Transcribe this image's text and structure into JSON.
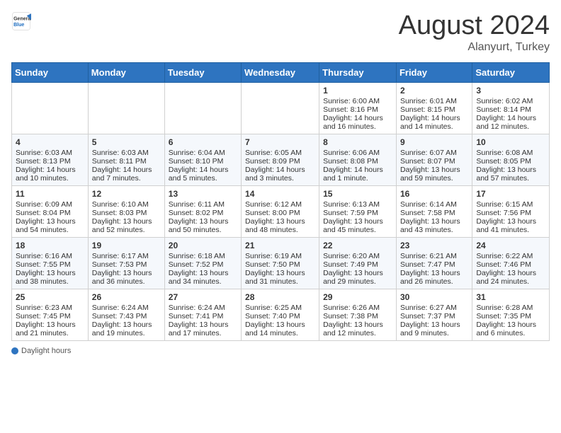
{
  "header": {
    "logo_general": "General",
    "logo_blue": "Blue",
    "title": "August 2024",
    "location": "Alanyurt, Turkey"
  },
  "days_of_week": [
    "Sunday",
    "Monday",
    "Tuesday",
    "Wednesday",
    "Thursday",
    "Friday",
    "Saturday"
  ],
  "weeks": [
    [
      {
        "day": "",
        "sunrise": "",
        "sunset": "",
        "daylight": ""
      },
      {
        "day": "",
        "sunrise": "",
        "sunset": "",
        "daylight": ""
      },
      {
        "day": "",
        "sunrise": "",
        "sunset": "",
        "daylight": ""
      },
      {
        "day": "",
        "sunrise": "",
        "sunset": "",
        "daylight": ""
      },
      {
        "day": "1",
        "sunrise": "Sunrise: 6:00 AM",
        "sunset": "Sunset: 8:16 PM",
        "daylight": "Daylight: 14 hours and 16 minutes."
      },
      {
        "day": "2",
        "sunrise": "Sunrise: 6:01 AM",
        "sunset": "Sunset: 8:15 PM",
        "daylight": "Daylight: 14 hours and 14 minutes."
      },
      {
        "day": "3",
        "sunrise": "Sunrise: 6:02 AM",
        "sunset": "Sunset: 8:14 PM",
        "daylight": "Daylight: 14 hours and 12 minutes."
      }
    ],
    [
      {
        "day": "4",
        "sunrise": "Sunrise: 6:03 AM",
        "sunset": "Sunset: 8:13 PM",
        "daylight": "Daylight: 14 hours and 10 minutes."
      },
      {
        "day": "5",
        "sunrise": "Sunrise: 6:03 AM",
        "sunset": "Sunset: 8:11 PM",
        "daylight": "Daylight: 14 hours and 7 minutes."
      },
      {
        "day": "6",
        "sunrise": "Sunrise: 6:04 AM",
        "sunset": "Sunset: 8:10 PM",
        "daylight": "Daylight: 14 hours and 5 minutes."
      },
      {
        "day": "7",
        "sunrise": "Sunrise: 6:05 AM",
        "sunset": "Sunset: 8:09 PM",
        "daylight": "Daylight: 14 hours and 3 minutes."
      },
      {
        "day": "8",
        "sunrise": "Sunrise: 6:06 AM",
        "sunset": "Sunset: 8:08 PM",
        "daylight": "Daylight: 14 hours and 1 minute."
      },
      {
        "day": "9",
        "sunrise": "Sunrise: 6:07 AM",
        "sunset": "Sunset: 8:07 PM",
        "daylight": "Daylight: 13 hours and 59 minutes."
      },
      {
        "day": "10",
        "sunrise": "Sunrise: 6:08 AM",
        "sunset": "Sunset: 8:05 PM",
        "daylight": "Daylight: 13 hours and 57 minutes."
      }
    ],
    [
      {
        "day": "11",
        "sunrise": "Sunrise: 6:09 AM",
        "sunset": "Sunset: 8:04 PM",
        "daylight": "Daylight: 13 hours and 54 minutes."
      },
      {
        "day": "12",
        "sunrise": "Sunrise: 6:10 AM",
        "sunset": "Sunset: 8:03 PM",
        "daylight": "Daylight: 13 hours and 52 minutes."
      },
      {
        "day": "13",
        "sunrise": "Sunrise: 6:11 AM",
        "sunset": "Sunset: 8:02 PM",
        "daylight": "Daylight: 13 hours and 50 minutes."
      },
      {
        "day": "14",
        "sunrise": "Sunrise: 6:12 AM",
        "sunset": "Sunset: 8:00 PM",
        "daylight": "Daylight: 13 hours and 48 minutes."
      },
      {
        "day": "15",
        "sunrise": "Sunrise: 6:13 AM",
        "sunset": "Sunset: 7:59 PM",
        "daylight": "Daylight: 13 hours and 45 minutes."
      },
      {
        "day": "16",
        "sunrise": "Sunrise: 6:14 AM",
        "sunset": "Sunset: 7:58 PM",
        "daylight": "Daylight: 13 hours and 43 minutes."
      },
      {
        "day": "17",
        "sunrise": "Sunrise: 6:15 AM",
        "sunset": "Sunset: 7:56 PM",
        "daylight": "Daylight: 13 hours and 41 minutes."
      }
    ],
    [
      {
        "day": "18",
        "sunrise": "Sunrise: 6:16 AM",
        "sunset": "Sunset: 7:55 PM",
        "daylight": "Daylight: 13 hours and 38 minutes."
      },
      {
        "day": "19",
        "sunrise": "Sunrise: 6:17 AM",
        "sunset": "Sunset: 7:53 PM",
        "daylight": "Daylight: 13 hours and 36 minutes."
      },
      {
        "day": "20",
        "sunrise": "Sunrise: 6:18 AM",
        "sunset": "Sunset: 7:52 PM",
        "daylight": "Daylight: 13 hours and 34 minutes."
      },
      {
        "day": "21",
        "sunrise": "Sunrise: 6:19 AM",
        "sunset": "Sunset: 7:50 PM",
        "daylight": "Daylight: 13 hours and 31 minutes."
      },
      {
        "day": "22",
        "sunrise": "Sunrise: 6:20 AM",
        "sunset": "Sunset: 7:49 PM",
        "daylight": "Daylight: 13 hours and 29 minutes."
      },
      {
        "day": "23",
        "sunrise": "Sunrise: 6:21 AM",
        "sunset": "Sunset: 7:47 PM",
        "daylight": "Daylight: 13 hours and 26 minutes."
      },
      {
        "day": "24",
        "sunrise": "Sunrise: 6:22 AM",
        "sunset": "Sunset: 7:46 PM",
        "daylight": "Daylight: 13 hours and 24 minutes."
      }
    ],
    [
      {
        "day": "25",
        "sunrise": "Sunrise: 6:23 AM",
        "sunset": "Sunset: 7:45 PM",
        "daylight": "Daylight: 13 hours and 21 minutes."
      },
      {
        "day": "26",
        "sunrise": "Sunrise: 6:24 AM",
        "sunset": "Sunset: 7:43 PM",
        "daylight": "Daylight: 13 hours and 19 minutes."
      },
      {
        "day": "27",
        "sunrise": "Sunrise: 6:24 AM",
        "sunset": "Sunset: 7:41 PM",
        "daylight": "Daylight: 13 hours and 17 minutes."
      },
      {
        "day": "28",
        "sunrise": "Sunrise: 6:25 AM",
        "sunset": "Sunset: 7:40 PM",
        "daylight": "Daylight: 13 hours and 14 minutes."
      },
      {
        "day": "29",
        "sunrise": "Sunrise: 6:26 AM",
        "sunset": "Sunset: 7:38 PM",
        "daylight": "Daylight: 13 hours and 12 minutes."
      },
      {
        "day": "30",
        "sunrise": "Sunrise: 6:27 AM",
        "sunset": "Sunset: 7:37 PM",
        "daylight": "Daylight: 13 hours and 9 minutes."
      },
      {
        "day": "31",
        "sunrise": "Sunrise: 6:28 AM",
        "sunset": "Sunset: 7:35 PM",
        "daylight": "Daylight: 13 hours and 6 minutes."
      }
    ]
  ],
  "legend": {
    "label": "Daylight hours"
  }
}
